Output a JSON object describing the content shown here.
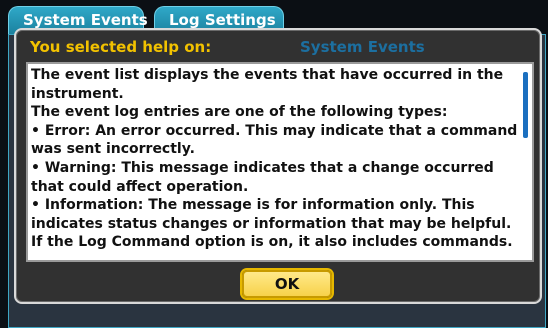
{
  "background": {
    "tabs": [
      {
        "label": "System Events"
      },
      {
        "label": "Log Settings"
      }
    ]
  },
  "dialog": {
    "header_label": "You selected help on:",
    "topic": "System Events",
    "help_lines": [
      "The event list displays the events that have occurred in the instrument.",
      "The event log entries are one of the following types:",
      "• Error: An error occurred. This may indicate that a command was sent incorrectly.",
      "• Warning: This message indicates that a change occurred that could affect operation.",
      "• Information: The message is for information only. This indicates status changes or information that may be helpful. If the Log Command option is on, it also includes commands."
    ],
    "ok_label": "OK"
  },
  "colors": {
    "header_label": "#f2c200",
    "topic": "#1c6fa0",
    "ok_button": "#f7d24a",
    "scroll_thumb": "#1b6fbf"
  }
}
